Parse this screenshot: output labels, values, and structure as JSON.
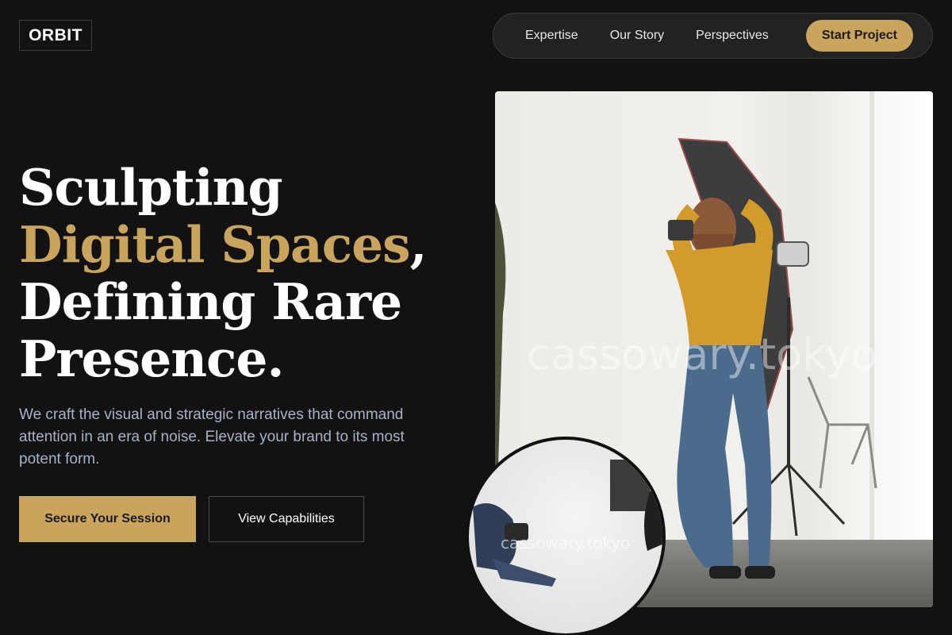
{
  "logo": {
    "text": "ORBIT"
  },
  "nav": {
    "links": [
      {
        "label": "Expertise"
      },
      {
        "label": "Our Story"
      },
      {
        "label": "Perspectives"
      }
    ],
    "cta_label": "Start Project"
  },
  "hero": {
    "headline": {
      "line1": "Sculpting",
      "line2_accent": "Digital Spaces",
      "line2_tail": ",",
      "line3": "Defining Rare",
      "line4": "Presence."
    },
    "lead": "We craft the visual and strategic narratives that command attention in an era of noise. Elevate your brand to its most potent form.",
    "primary_button": "Secure Your Session",
    "secondary_button": "View Capabilities"
  },
  "media": {
    "main_watermark": "cassowary.tokyo",
    "inset_watermark": "cassowary.tokyo"
  },
  "colors": {
    "background": "#121212",
    "accent": "#c9a45c",
    "lead_text": "#a7b2c6",
    "nav_bg": "#222222"
  }
}
